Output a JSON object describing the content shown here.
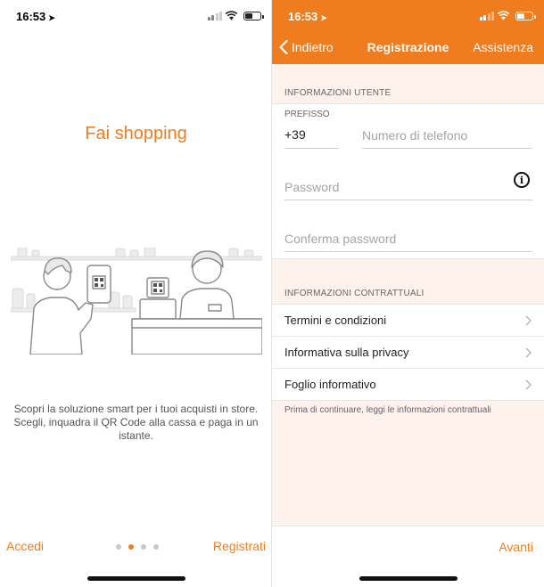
{
  "status": {
    "time": "16:53"
  },
  "onboarding": {
    "title": "Fai shopping",
    "description": "Scopri la soluzione smart per i tuoi acquisti in store. Scegli, inquadra il QR Code alla cassa e paga in un istante.",
    "login_label": "Accedi",
    "register_label": "Registrati",
    "page_count": 4,
    "active_page": 2
  },
  "registration": {
    "back_label": "Indietro",
    "title": "Registrazione",
    "help_label": "Assistenza",
    "user_info_header": "INFORMAZIONI UTENTE",
    "prefix_label": "PREFISSO",
    "prefix_value": "+39",
    "phone_placeholder": "Numero di telefono",
    "password_placeholder": "Password",
    "confirm_password_placeholder": "Conferma password",
    "contract_header": "INFORMAZIONI CONTRATTUALI",
    "contract_items": [
      {
        "label": "Termini e condizioni"
      },
      {
        "label": "Informativa sulla privacy"
      },
      {
        "label": "Foglio informativo"
      }
    ],
    "contract_note": "Prima di continuare, leggi le informazioni contrattuali",
    "next_label": "Avanti"
  },
  "colors": {
    "accent": "#ef7d1f",
    "background": "#fdf2ec"
  }
}
